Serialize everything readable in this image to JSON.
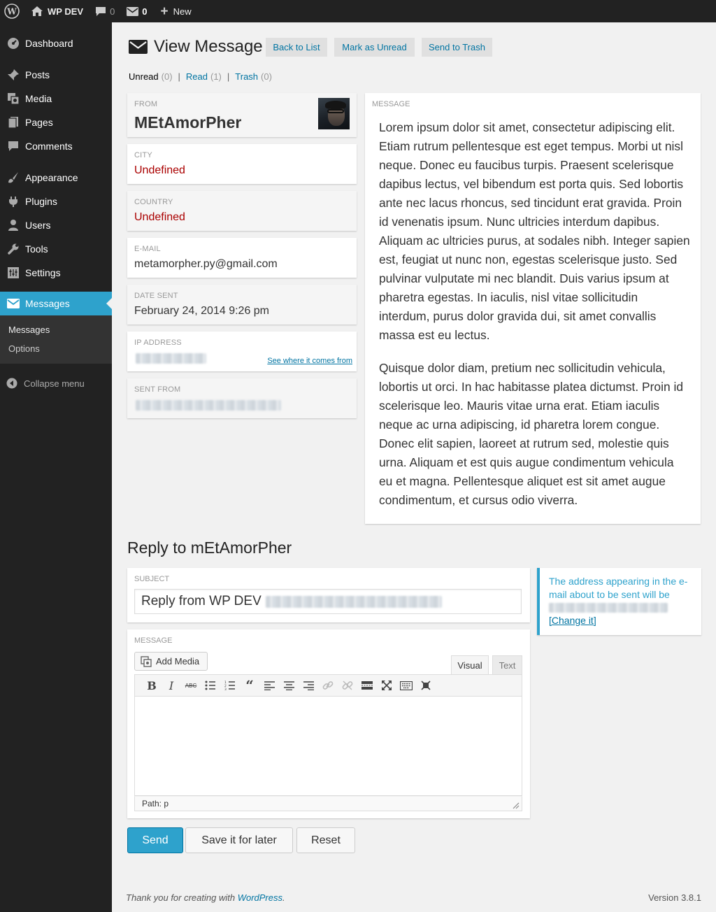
{
  "adminbar": {
    "site_name": "WP DEV",
    "comments_count": "0",
    "messages_count": "0",
    "new_label": "New"
  },
  "sidebar": {
    "items": [
      {
        "label": "Dashboard",
        "icon": "dashboard-icon"
      },
      {
        "label": "Posts",
        "icon": "pin-icon"
      },
      {
        "label": "Media",
        "icon": "media-icon"
      },
      {
        "label": "Pages",
        "icon": "pages-icon"
      },
      {
        "label": "Comments",
        "icon": "comment-icon"
      },
      {
        "label": "Appearance",
        "icon": "brush-icon"
      },
      {
        "label": "Plugins",
        "icon": "plug-icon"
      },
      {
        "label": "Users",
        "icon": "user-icon"
      },
      {
        "label": "Tools",
        "icon": "wrench-icon"
      },
      {
        "label": "Settings",
        "icon": "settings-icon"
      },
      {
        "label": "Messages",
        "icon": "envelope-icon"
      }
    ],
    "submenu": [
      "Messages",
      "Options"
    ],
    "collapse_label": "Collapse menu"
  },
  "header": {
    "title": "View Message",
    "back_button": "Back to List",
    "unread_button": "Mark as Unread",
    "trash_button": "Send to Trash"
  },
  "filters": [
    {
      "label": "Unread",
      "count": "(0)"
    },
    {
      "label": "Read",
      "count": "(1)"
    },
    {
      "label": "Trash",
      "count": "(0)"
    }
  ],
  "filter_separator": "|",
  "info": {
    "from_label": "FROM",
    "from_value": "MEtAmorPher",
    "city_label": "CITY",
    "city_value": "Undefined",
    "country_label": "COUNTRY",
    "country_value": "Undefined",
    "email_label": "E-MAIL",
    "email_value": "metamorpher.py@gmail.com",
    "date_label": "DATE SENT",
    "date_value": "February 24, 2014 9:26 pm",
    "ip_label": "IP ADDRESS",
    "ip_link": "See where it comes from",
    "sentfrom_label": "SENT FROM"
  },
  "message": {
    "label": "MESSAGE",
    "paragraphs": [
      "Lorem ipsum dolor sit amet, consectetur adipiscing elit. Etiam rutrum pellentesque est eget tempus. Morbi ut nisl neque. Donec eu faucibus turpis. Praesent scelerisque dapibus lectus, vel bibendum est porta quis. Sed lobortis ante nec lacus rhoncus, sed tincidunt erat gravida. Proin id venenatis ipsum. Nunc ultricies interdum dapibus. Aliquam ac ultricies purus, at sodales nibh. Integer sapien est, feugiat ut nunc non, egestas scelerisque justo. Sed pulvinar vulputate mi nec blandit. Duis varius ipsum at pharetra egestas. In iaculis, nisl vitae sollicitudin interdum, purus dolor gravida dui, sit amet convallis massa est eu lectus.",
      "Quisque dolor diam, pretium nec sollicitudin vehicula, lobortis ut orci. In hac habitasse platea dictumst. Proin id scelerisque leo. Mauris vitae urna erat. Etiam iaculis neque ac urna adipiscing, id pharetra lorem congue. Donec elit sapien, laoreet at rutrum sed, molestie quis urna. Aliquam et est quis augue condimentum vehicula eu et magna. Pellentesque aliquet est sit amet augue condimentum, et cursus odio viverra."
    ]
  },
  "reply": {
    "title": "Reply to mEtAmorPher",
    "subject_label": "SUBJECT",
    "subject_value": "Reply from WP DEV",
    "notice_text": "The address appearing in the e-mail about to be sent will be",
    "notice_link": "[Change it]",
    "message_label": "MESSAGE",
    "add_media": "Add Media",
    "tab_visual": "Visual",
    "tab_text": "Text",
    "path": "Path: p",
    "toolbar_icons": [
      "bold-icon",
      "italic-icon",
      "strikethrough-icon",
      "bullet-list-icon",
      "numbered-list-icon",
      "blockquote-icon",
      "align-left-icon",
      "align-center-icon",
      "align-right-icon",
      "link-icon",
      "unlink-icon",
      "more-tag-icon",
      "fullscreen-icon",
      "keyboard-icon",
      "distraction-free-icon"
    ]
  },
  "buttons": {
    "send": "Send",
    "save": "Save it for later",
    "reset": "Reset"
  },
  "footer": {
    "thanks_prefix": "Thank you for creating with ",
    "thanks_link": "WordPress",
    "thanks_suffix": ".",
    "version": "Version 3.8.1"
  },
  "colors": {
    "accent": "#2ea2cc",
    "link": "#0074a2",
    "sidebar": "#222222",
    "undefined_red": "#aa0000"
  }
}
